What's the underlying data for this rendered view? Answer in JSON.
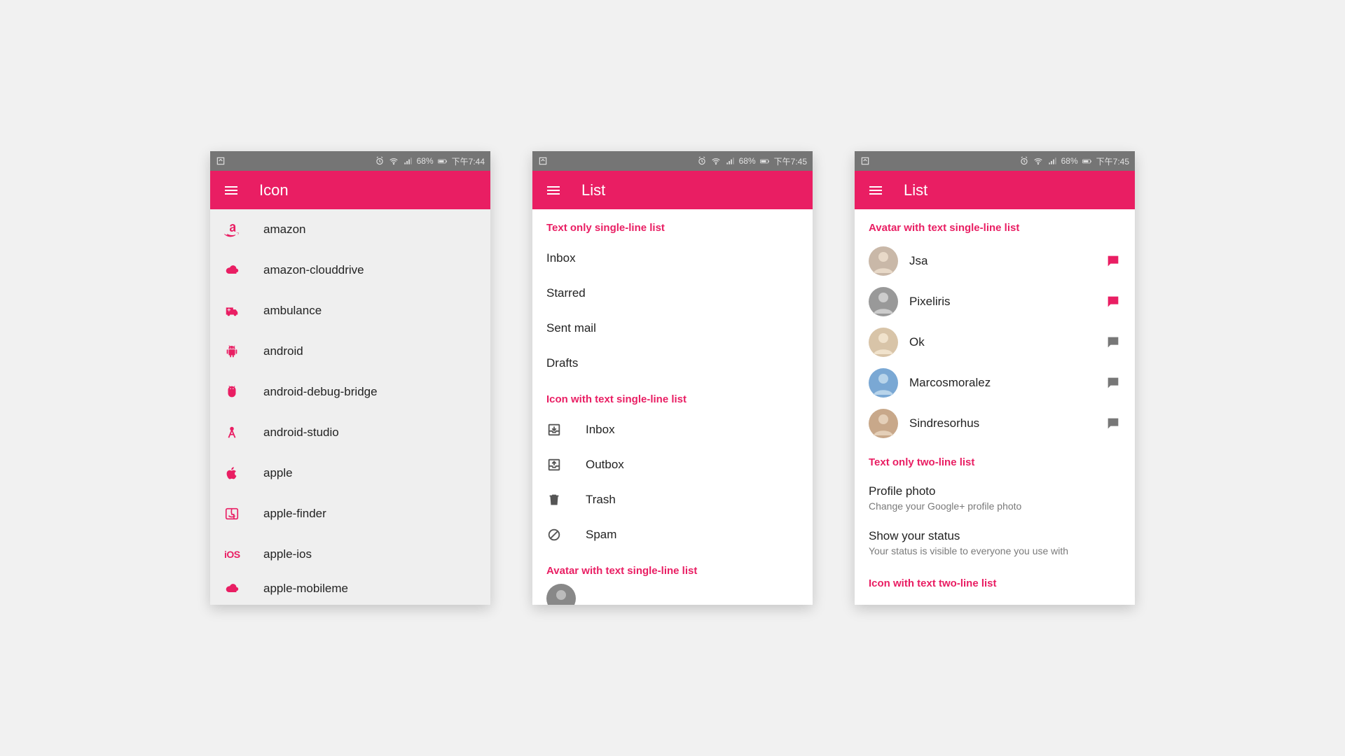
{
  "statusbar": {
    "battery": "68%",
    "time1": "下午7:44",
    "time2": "下午7:45"
  },
  "accent": "#e91e63",
  "screen1": {
    "title": "Icon",
    "items": [
      {
        "label": "amazon",
        "icon": "amazon"
      },
      {
        "label": "amazon-clouddrive",
        "icon": "cloud"
      },
      {
        "label": "ambulance",
        "icon": "ambulance"
      },
      {
        "label": "android",
        "icon": "android"
      },
      {
        "label": "android-debug-bridge",
        "icon": "adb"
      },
      {
        "label": "android-studio",
        "icon": "compass"
      },
      {
        "label": "apple",
        "icon": "apple"
      },
      {
        "label": "apple-finder",
        "icon": "finder"
      },
      {
        "label": "apple-ios",
        "icon": "ios"
      },
      {
        "label": "apple-mobileme",
        "icon": "mobileme"
      }
    ]
  },
  "screen2": {
    "title": "List",
    "section1": "Text only single-line list",
    "textList": [
      "Inbox",
      "Starred",
      "Sent mail",
      "Drafts"
    ],
    "section2": "Icon with text single-line list",
    "iconList": [
      {
        "label": "Inbox",
        "icon": "inbox"
      },
      {
        "label": "Outbox",
        "icon": "outbox"
      },
      {
        "label": "Trash",
        "icon": "trash"
      },
      {
        "label": "Spam",
        "icon": "block"
      }
    ],
    "section3": "Avatar with text single-line list"
  },
  "screen3": {
    "title": "List",
    "section1": "Avatar with text single-line list",
    "contacts": [
      {
        "name": "Jsa",
        "chat": "active"
      },
      {
        "name": "Pixeliris",
        "chat": "active"
      },
      {
        "name": "Ok",
        "chat": "inactive"
      },
      {
        "name": "Marcosmoralez",
        "chat": "inactive"
      },
      {
        "name": "Sindresorhus",
        "chat": "inactive"
      }
    ],
    "section2": "Text only two-line list",
    "twoLine": [
      {
        "primary": "Profile photo",
        "secondary": "Change your Google+ profile photo"
      },
      {
        "primary": "Show your status",
        "secondary": "Your status is visible to everyone you use with"
      }
    ],
    "section3": "Icon with text two-line list"
  }
}
